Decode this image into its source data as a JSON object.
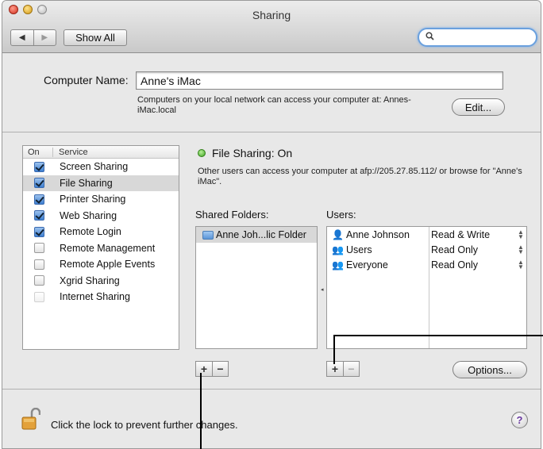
{
  "window": {
    "title": "Sharing"
  },
  "toolbar": {
    "back_icon": "◀",
    "forward_icon": "▶",
    "show_all_label": "Show All",
    "search_placeholder": "",
    "search_icon": "🔍"
  },
  "computer_name": {
    "label": "Computer Name:",
    "value": "Anne's iMac",
    "info": "Computers on your local network can access your computer at: Annes-iMac.local",
    "edit_label": "Edit..."
  },
  "services": {
    "header_on": "On",
    "header_service": "Service",
    "items": [
      {
        "label": "Screen Sharing",
        "checked": true,
        "selected": false
      },
      {
        "label": "File Sharing",
        "checked": true,
        "selected": true
      },
      {
        "label": "Printer Sharing",
        "checked": true,
        "selected": false
      },
      {
        "label": "Web Sharing",
        "checked": true,
        "selected": false
      },
      {
        "label": "Remote Login",
        "checked": true,
        "selected": false
      },
      {
        "label": "Remote Management",
        "checked": false,
        "selected": false
      },
      {
        "label": "Remote Apple Events",
        "checked": false,
        "selected": false
      },
      {
        "label": "Xgrid Sharing",
        "checked": false,
        "selected": false
      },
      {
        "label": "Internet Sharing",
        "checked": false,
        "selected": false
      }
    ]
  },
  "file_sharing": {
    "status": "File Sharing: On",
    "status_color": "#3ea320",
    "description": "Other users can access your computer at afp://205.27.85.112/ or browse for \"Anne's iMac\".",
    "shared_folders_label": "Shared Folders:",
    "users_label": "Users:",
    "shared_folders": [
      {
        "name": "Anne Joh...lic Folder"
      }
    ],
    "users": [
      {
        "name": "Anne Johnson",
        "icon": "👤",
        "permission": "Read & Write"
      },
      {
        "name": "Users",
        "icon": "👥",
        "permission": "Read Only"
      },
      {
        "name": "Everyone",
        "icon": "👥",
        "permission": "Read Only"
      }
    ],
    "plus_label": "+",
    "minus_label": "−",
    "options_label": "Options..."
  },
  "footer": {
    "lock_text": "Click the lock to prevent further changes.",
    "help_label": "?"
  }
}
